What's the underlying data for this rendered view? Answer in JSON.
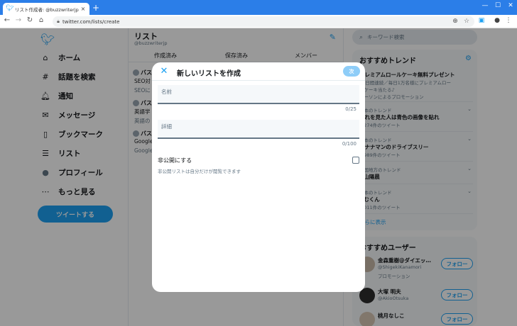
{
  "browser": {
    "tab_title": "リスト作成者: @buzzwriterjp / Tw",
    "tab_close": "×",
    "new_tab": "+",
    "url": "twitter.com/lists/create",
    "window_controls": [
      "—",
      "☐",
      "✕"
    ]
  },
  "sidebar": {
    "items": [
      {
        "icon": "home-icon",
        "glyph": "⌂",
        "label": "ホーム"
      },
      {
        "icon": "hashtag-icon",
        "glyph": "#",
        "label": "話題を検索"
      },
      {
        "icon": "bell-icon",
        "glyph": "🔔︎",
        "label": "通知"
      },
      {
        "icon": "envelope-icon",
        "glyph": "✉",
        "label": "メッセージ"
      },
      {
        "icon": "bookmark-icon",
        "glyph": "▯",
        "label": "ブックマーク"
      },
      {
        "icon": "list-icon",
        "glyph": "☰",
        "label": "リスト"
      },
      {
        "icon": "avatar-icon",
        "glyph": "●",
        "label": "プロフィール"
      },
      {
        "icon": "more-icon",
        "glyph": "⋯",
        "label": "もっと見る"
      }
    ],
    "tweet_button": "ツイートする"
  },
  "center": {
    "title": "リスト",
    "handle": "@buzzwriterjp",
    "tabs": [
      "作成済み",
      "保存済み",
      "メンバー"
    ],
    "rows": [
      {
        "name": "バス",
        "line1": "SEO対",
        "line2": "SEOに"
      },
      {
        "name": "バス",
        "line1": "英語学",
        "line2": "英語の"
      },
      {
        "name": "バス",
        "line1": "Google",
        "line2": "Google"
      }
    ]
  },
  "right": {
    "search_placeholder": "キーワード検索",
    "trends_title": "おすすめトレンド",
    "trends": [
      {
        "meta": "",
        "name": "プレミアムロールケーキ無料プレゼント",
        "name2": "10日間連続／毎日1万名様にプレミアムロー",
        "sub": "ルケーキ当たる♪",
        "promo": "ローソンによるプロモーション"
      },
      {
        "meta": "日本のトレンド",
        "name": "これを見た人は青色の画像を貼れ",
        "sub": "2,274件のツイート"
      },
      {
        "meta": "日本のトレンド",
        "name": "アナナマンのドライブスリー",
        "sub": "1,989件のツイート"
      },
      {
        "meta": "中国地方のトレンド",
        "name": "#山陽晨",
        "sub": ""
      },
      {
        "meta": "日本のトレンド",
        "name": "#むくん",
        "sub": "1,011件のツイート"
      }
    ],
    "more_link": "さらに表示",
    "users_title": "おすすめユーザー",
    "users": [
      {
        "name": "金森重樹@ダイエッ…",
        "handle": "@ShigekiKanamori",
        "promo": "プロモーション",
        "follow": "フォロー"
      },
      {
        "name": "大塚 明夫",
        "handle": "@AkioOtsuka",
        "promo": "",
        "follow": "フォロー"
      },
      {
        "name": "桃月なしこ",
        "handle": "",
        "promo": "",
        "follow": "フォロー"
      }
    ]
  },
  "modal": {
    "title": "新しいリストを作成",
    "next_button": "次",
    "name_label": "名前",
    "name_count": "0/25",
    "detail_label": "詳細",
    "detail_count": "0/100",
    "private_label": "非公開にする",
    "private_desc": "非公開リストは自分だけが閲覧できます"
  }
}
